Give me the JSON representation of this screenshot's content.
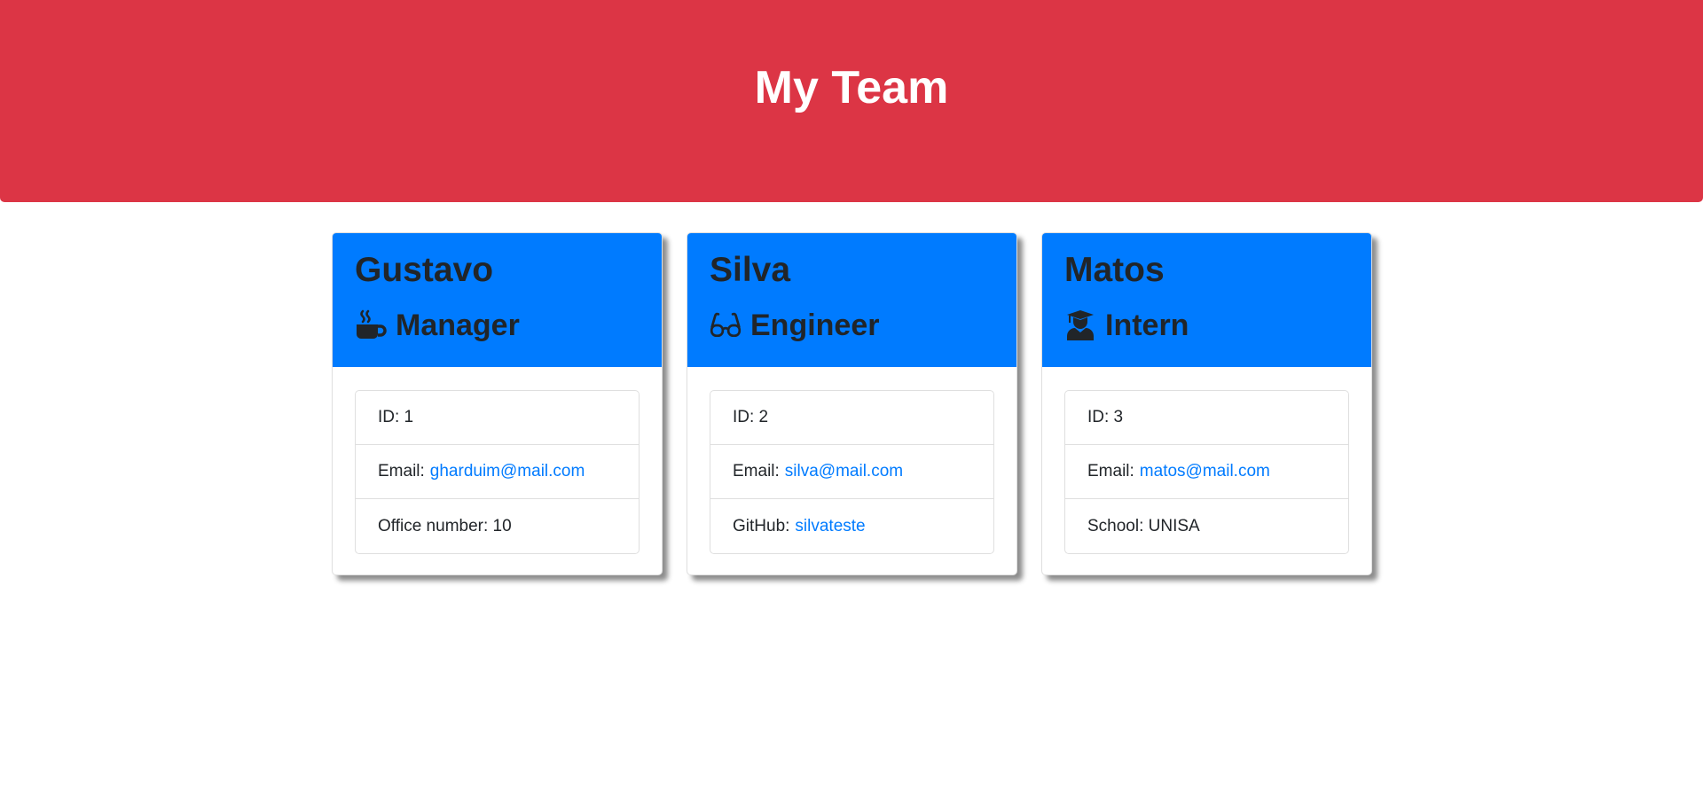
{
  "header": {
    "title": "My Team"
  },
  "colors": {
    "banner": "#dc3545",
    "card_header": "#007bff",
    "link": "#007bff"
  },
  "team": [
    {
      "name": "Gustavo",
      "role": "Manager",
      "role_icon": "coffee-mug-icon",
      "id_label": "ID: 1",
      "email_label": "Email:",
      "email": "gharduim@mail.com",
      "extra_label": "Office number: 10",
      "extra_link": ""
    },
    {
      "name": "Silva",
      "role": "Engineer",
      "role_icon": "glasses-icon",
      "id_label": "ID: 2",
      "email_label": "Email:",
      "email": "silva@mail.com",
      "extra_label": "GitHub:",
      "extra_link": "silvateste"
    },
    {
      "name": "Matos",
      "role": "Intern",
      "role_icon": "graduate-icon",
      "id_label": "ID: 3",
      "email_label": "Email:",
      "email": "matos@mail.com",
      "extra_label": "School: UNISA",
      "extra_link": ""
    }
  ]
}
